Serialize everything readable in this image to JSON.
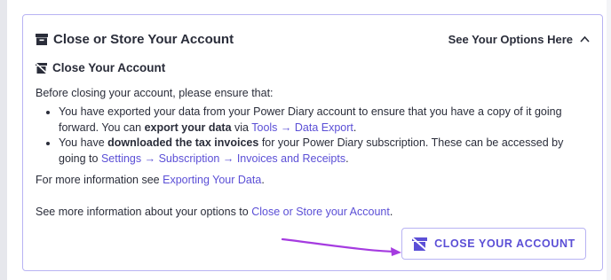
{
  "panel": {
    "title": "Close or Store Your Account",
    "toggle_label": "See Your Options Here"
  },
  "section": {
    "title": "Close Your Account",
    "intro": "Before closing your account, please ensure that:",
    "bullet1": {
      "text_a": "You have exported your data from your Power Diary account to ensure that you have a copy of it going forward. You can ",
      "bold": "export your data",
      "text_b": " via ",
      "link": "Tools → Data Export",
      "text_c": "."
    },
    "bullet2": {
      "text_a": "You have ",
      "bold": "downloaded the tax invoices",
      "text_b": " for your Power Diary subscription. These can be accessed by going to ",
      "link": "Settings → Subscription → Invoices and Receipts",
      "text_c": "."
    },
    "more_info_prefix": "For more information see ",
    "more_info_link": "Exporting Your Data",
    "more_info_suffix": ".",
    "options_prefix": "See more information about your options to ",
    "options_link": "Close or Store your Account",
    "options_suffix": "."
  },
  "close_button": {
    "label": "CLOSE YOUR ACCOUNT"
  },
  "colors": {
    "accent": "#5b4fd6",
    "panel_border": "#b8b3f3",
    "arrow": "#a53be0",
    "text": "#2a2d3a"
  },
  "icons": {
    "panel_title": "archive-box-icon",
    "section_title": "account-close-icon",
    "toggle": "chevron-up-icon",
    "button": "account-close-icon"
  }
}
